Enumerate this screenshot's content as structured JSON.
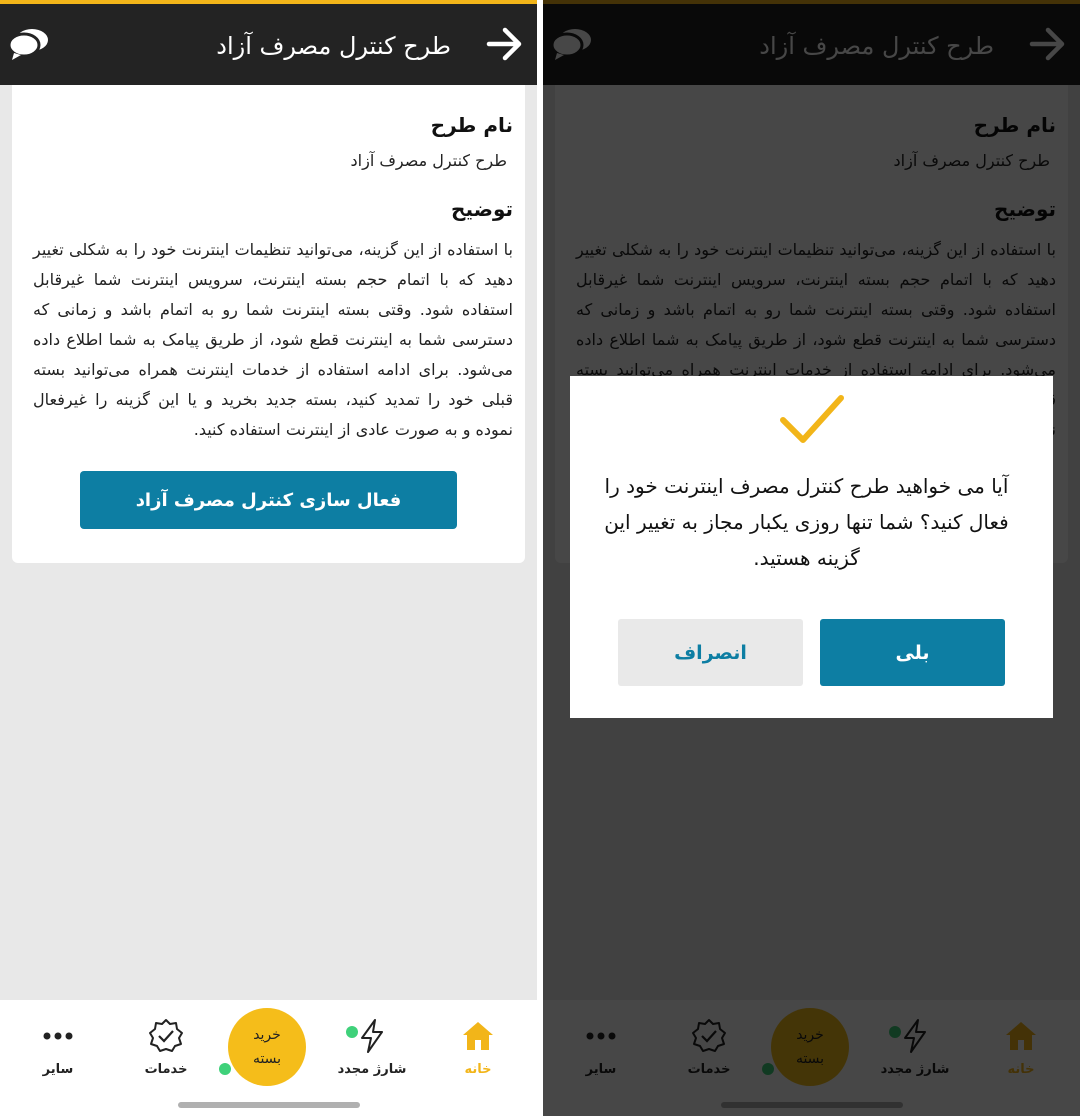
{
  "header": {
    "title": "طرح کنترل مصرف آزاد",
    "back_icon": "arrow-right-icon",
    "chat_icon": "chat-bubbles-icon"
  },
  "plan": {
    "name_label": "نام طرح",
    "name_value": "طرح کنترل مصرف آزاد",
    "desc_label": "توضیح",
    "description": "با استفاده از این گزینه، می‌توانید تنظیمات اینترنت خود را به شکلی تغییر دهید که با اتمام حجم بسته اینترنت، سرویس اینترنت شما غیرقابل استفاده شود. وقتی بسته اینترنت شما رو به اتمام باشد و زمانی که دسترسی شما به اینترنت قطع شود، از طریق پیامک به شما اطلاع داده می‌شود. برای ادامه استفاده از خدمات اینترنت همراه می‌توانید بسته قبلی خود را تمدید کنید، بسته جدید بخرید و یا این گزینه را غیرفعال نموده و به صورت عادی از اینترنت استفاده کنید.",
    "activate_label": "فعال سازی کنترل مصرف آزاد"
  },
  "nav": {
    "home": "خانه",
    "recharge": "شارژ مجدد",
    "buy_line1": "خرید",
    "buy_line2": "بسته",
    "services": "خدمات",
    "more": "سایر"
  },
  "dialog": {
    "icon": "checkmark-icon",
    "message": "آیا می خواهید طرح کنترل مصرف اینترنت خود را فعال کنید؟ شما تنها روزی یکبار مجاز به تغییر این گزینه هستید.",
    "yes_label": "بلی",
    "cancel_label": "انصراف"
  },
  "colors": {
    "accent_yellow": "#f2b519",
    "primary_blue": "#0d7ea3",
    "status_green": "#3fd17a",
    "header_dark": "#232323"
  }
}
